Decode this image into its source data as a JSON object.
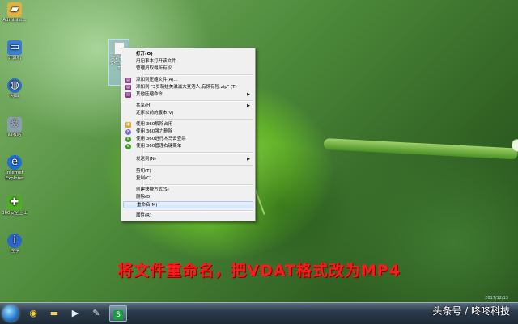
{
  "desktop": {
    "icons": [
      {
        "label": "Administ...",
        "icon": "folder-user-icon",
        "color": "#e0b040"
      },
      {
        "label": "计算机",
        "icon": "computer-icon",
        "color": "#3a7bd5"
      },
      {
        "label": "网络",
        "icon": "network-icon",
        "color": "#2f6fc0"
      },
      {
        "label": "回收站",
        "icon": "recycle-bin-icon",
        "color": "#8aa0b0"
      },
      {
        "label": "Internet Explorer",
        "icon": "ie-icon",
        "color": "#1e6fd0"
      },
      {
        "label": "360安全卫士",
        "icon": "360-security-icon",
        "color": "#4caf20"
      },
      {
        "label": "程序",
        "icon": "info-icon",
        "color": "#2a66c8"
      }
    ],
    "selected_file_name": "文调视频文件.VDAT"
  },
  "context_menu": {
    "items": [
      {
        "label": "打开(O)",
        "bold": true,
        "icon": "",
        "submenu": false
      },
      {
        "label": "用记事本打开该文件",
        "icon": "",
        "submenu": false
      },
      {
        "label": "管理员取得所有权",
        "icon": "",
        "submenu": false
      },
      {
        "sep": true
      },
      {
        "label": "添加到压缩文件(A)...",
        "icon": "winrar-icon",
        "submenu": false
      },
      {
        "label": "添加到 \"3岁萌娃美滋滋大变活人,有惊有险.zip\" (T)",
        "icon": "winrar-icon",
        "submenu": false
      },
      {
        "label": "其他压缩命令",
        "icon": "winrar-icon",
        "submenu": true
      },
      {
        "sep": true
      },
      {
        "label": "共享(H)",
        "icon": "",
        "submenu": true
      },
      {
        "label": "还原以前的版本(V)",
        "icon": "",
        "submenu": false
      },
      {
        "sep": true
      },
      {
        "label": "使用 360解除占用",
        "icon": "360-unlock-icon",
        "submenu": false
      },
      {
        "label": "使用 360强力删除",
        "icon": "360-delete-icon",
        "submenu": false
      },
      {
        "label": "使用 360进行木马云查杀",
        "icon": "360-scan-icon",
        "submenu": false
      },
      {
        "label": "使用 360管理右键菜单",
        "icon": "360-menu-icon",
        "submenu": false
      },
      {
        "sep": true
      },
      {
        "label": "发送到(N)",
        "icon": "",
        "submenu": true
      },
      {
        "sep": true
      },
      {
        "label": "剪切(T)",
        "icon": "",
        "submenu": false
      },
      {
        "label": "复制(C)",
        "icon": "",
        "submenu": false
      },
      {
        "sep": true
      },
      {
        "label": "创建快捷方式(S)",
        "icon": "",
        "submenu": false
      },
      {
        "label": "删除(D)",
        "icon": "",
        "submenu": false
      },
      {
        "label": "重命名(M)",
        "icon": "",
        "submenu": false,
        "highlight": true
      },
      {
        "sep": true
      },
      {
        "label": "属性(R)",
        "icon": "",
        "submenu": false
      }
    ]
  },
  "caption": "将文件重命名，把VDAT格式改为MP4",
  "taskbar": {
    "buttons": [
      {
        "icon": "360-browser-icon"
      },
      {
        "icon": "file-explorer-icon"
      },
      {
        "icon": "media-player-icon"
      },
      {
        "icon": "paint-icon"
      },
      {
        "icon": "wps-spreadsheet-icon",
        "active": true
      }
    ],
    "clock": "2017/12/13"
  },
  "watermark": "头条号 / 咚咚科技"
}
